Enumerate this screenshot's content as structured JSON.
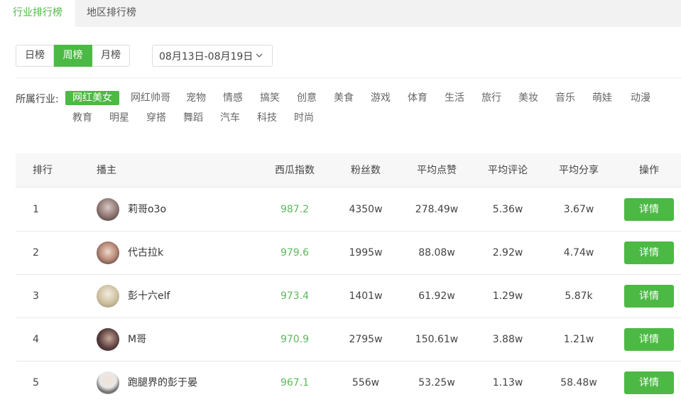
{
  "tabs": [
    {
      "label": "行业排行榜",
      "active": true
    },
    {
      "label": "地区排行榜",
      "active": false
    }
  ],
  "periods": [
    {
      "label": "日榜",
      "active": false
    },
    {
      "label": "周榜",
      "active": true
    },
    {
      "label": "月榜",
      "active": false
    }
  ],
  "date_range": "08月13日-08月19日",
  "industry": {
    "label": "所属行业:",
    "tags": [
      "网红美女",
      "网红帅哥",
      "宠物",
      "情感",
      "搞笑",
      "创意",
      "美食",
      "游戏",
      "体育",
      "生活",
      "旅行",
      "美妆",
      "音乐",
      "萌娃",
      "动漫",
      "教育",
      "明星",
      "穿搭",
      "舞蹈",
      "汽车",
      "科技",
      "时尚"
    ],
    "active_index": 0
  },
  "table": {
    "columns": [
      "排行",
      "播主",
      "西瓜指数",
      "粉丝数",
      "平均点赞",
      "平均评论",
      "平均分享",
      "操作"
    ],
    "rows": [
      {
        "rank": "1",
        "name": "莉哥o3o",
        "index": "987.2",
        "fans": "4350w",
        "likes": "278.49w",
        "comments": "5.36w",
        "shares": "3.67w",
        "action": "详情"
      },
      {
        "rank": "2",
        "name": "代古拉k",
        "index": "979.6",
        "fans": "1995w",
        "likes": "88.08w",
        "comments": "2.92w",
        "shares": "4.74w",
        "action": "详情"
      },
      {
        "rank": "3",
        "name": "彭十六elf",
        "index": "973.4",
        "fans": "1401w",
        "likes": "61.92w",
        "comments": "1.29w",
        "shares": "5.87k",
        "action": "详情"
      },
      {
        "rank": "4",
        "name": "M哥",
        "index": "970.9",
        "fans": "2795w",
        "likes": "150.61w",
        "comments": "3.88w",
        "shares": "1.21w",
        "action": "详情"
      },
      {
        "rank": "5",
        "name": "跑腿界的彭于晏",
        "index": "967.1",
        "fans": "556w",
        "likes": "53.25w",
        "comments": "1.13w",
        "shares": "58.48w",
        "action": "详情"
      }
    ]
  },
  "colors": {
    "accent": "#4cb944",
    "index_text": "#5cb85c"
  }
}
